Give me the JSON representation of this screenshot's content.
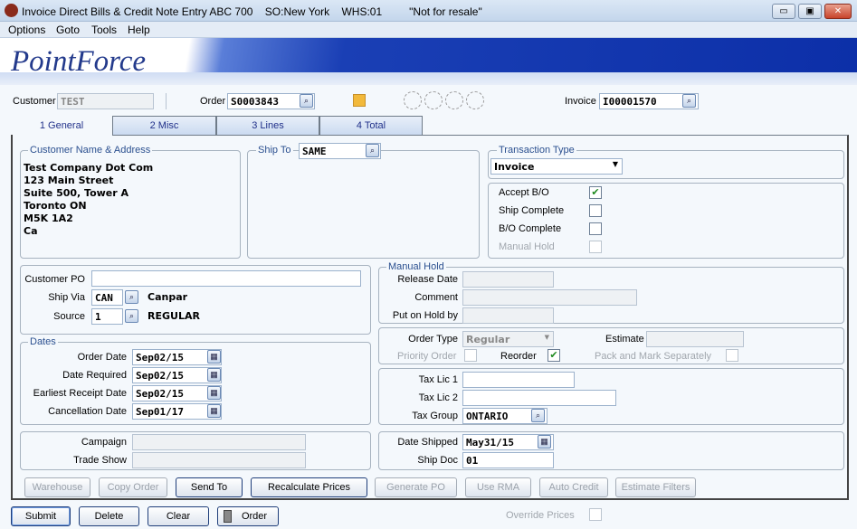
{
  "window": {
    "title": "Invoice Direct Bills & Credit Note Entry ABC 700    SO:New York    WHS:01         \"Not for resale\"",
    "minimize": "▭",
    "maximize": "▣",
    "close": "✕"
  },
  "menu": [
    "Options",
    "Goto",
    "Tools",
    "Help"
  ],
  "logo": "PointForce",
  "header": {
    "customer_label": "Customer",
    "customer_value": "TEST",
    "order_label": "Order",
    "order_value": "S0003843",
    "invoice_label": "Invoice",
    "invoice_value": "I00001570"
  },
  "tabs": [
    "1 General",
    "2 Misc",
    "3 Lines",
    "4 Total"
  ],
  "customer_address": {
    "title": "Customer Name & Address",
    "lines": [
      "Test Company Dot Com",
      "123 Main Street",
      "Suite 500, Tower A",
      "Toronto  ON",
      "M5K 1A2",
      "Ca"
    ]
  },
  "ship_to": {
    "title": "Ship To",
    "value": "SAME"
  },
  "transaction": {
    "title": "Transaction Type",
    "value": "Invoice"
  },
  "flags": {
    "accept_bo": "Accept B/O",
    "ship_complete": "Ship Complete",
    "bo_complete": "B/O Complete",
    "manual_hold": "Manual Hold",
    "accept_bo_checked": true
  },
  "shipping": {
    "customer_po_label": "Customer PO",
    "customer_po": "",
    "ship_via_label": "Ship Via",
    "ship_via": "CAN",
    "ship_via_desc": "Canpar",
    "source_label": "Source",
    "source": "1",
    "source_desc": "REGULAR"
  },
  "manual_hold": {
    "title": "Manual Hold",
    "release_date": "Release Date",
    "comment": "Comment",
    "put_on_hold_by": "Put on Hold by"
  },
  "dates": {
    "title": "Dates",
    "rows": [
      {
        "label": "Order Date",
        "value": "Sep02/15"
      },
      {
        "label": "Date Required",
        "value": "Sep02/15"
      },
      {
        "label": "Earliest Receipt Date",
        "value": "Sep02/15"
      },
      {
        "label": "Cancellation Date",
        "value": "Sep01/17"
      }
    ]
  },
  "order_type": {
    "label": "Order Type",
    "value": "Regular",
    "estimate": "Estimate",
    "priority_order": "Priority Order",
    "reorder": "Reorder",
    "reorder_checked": true,
    "pack_mark": "Pack and Mark Separately"
  },
  "tax": {
    "lic1": "Tax Lic 1",
    "lic2": "Tax Lic 2",
    "group_label": "Tax Group",
    "group_value": "ONTARIO"
  },
  "campaign": {
    "campaign": "Campaign",
    "trade_show": "Trade Show"
  },
  "ship": {
    "date_shipped_label": "Date Shipped",
    "date_shipped": "May31/15",
    "ship_doc_label": "Ship Doc",
    "ship_doc": "01"
  },
  "actions": [
    "Warehouse",
    "Copy Order",
    "Send To",
    "Recalculate Prices",
    "Generate PO",
    "Use RMA",
    "Auto Credit",
    "Estimate Filters"
  ],
  "bottom": {
    "submit": "Submit",
    "delete": "Delete",
    "clear": "Clear",
    "order": "Order",
    "override_prices": "Override Prices"
  }
}
